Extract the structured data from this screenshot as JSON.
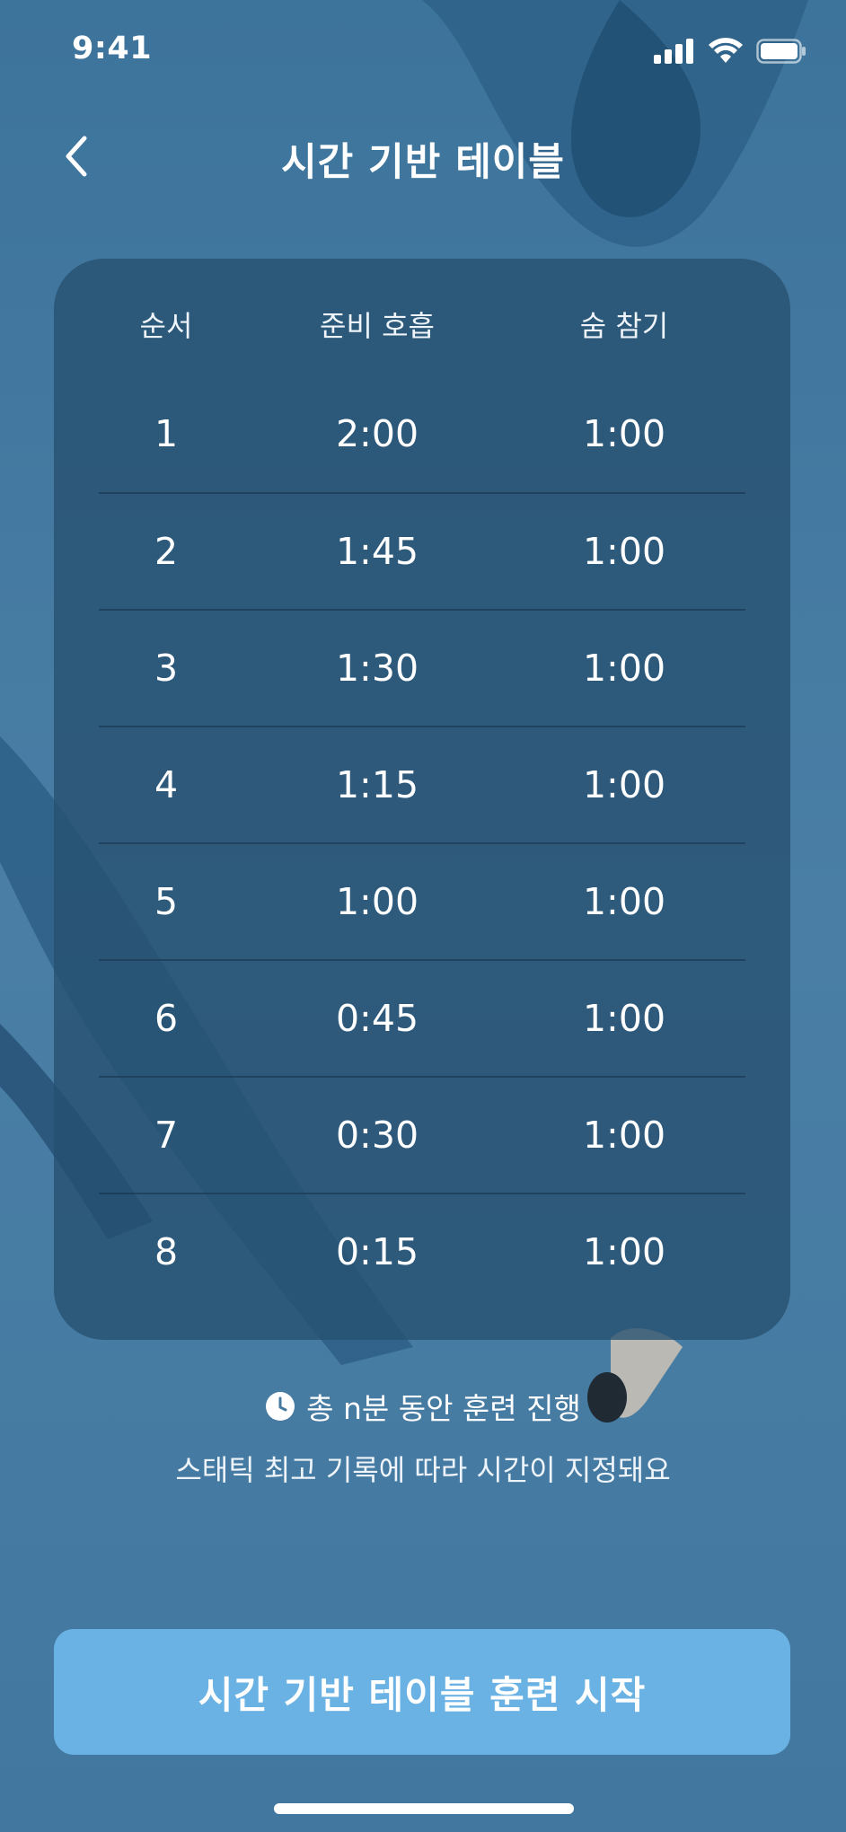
{
  "status_bar": {
    "time": "9:41"
  },
  "nav": {
    "title": "시간 기반 테이블"
  },
  "table": {
    "headers": [
      "순서",
      "준비 호흡",
      "숨 참기"
    ],
    "rows": [
      [
        "1",
        "2:00",
        "1:00"
      ],
      [
        "2",
        "1:45",
        "1:00"
      ],
      [
        "3",
        "1:30",
        "1:00"
      ],
      [
        "4",
        "1:15",
        "1:00"
      ],
      [
        "5",
        "1:00",
        "1:00"
      ],
      [
        "6",
        "0:45",
        "1:00"
      ],
      [
        "7",
        "0:30",
        "1:00"
      ],
      [
        "8",
        "0:15",
        "1:00"
      ]
    ]
  },
  "info": {
    "duration": "총 n분 동안 훈련 진행",
    "note": "스태틱 최고 기록에 따라 시간이 지정돼요"
  },
  "cta": {
    "label": "시간 기반 테이블 훈련 시작"
  },
  "colors": {
    "background": "#4479a0",
    "card": "#26506f",
    "cta": "#6bb2e4"
  }
}
